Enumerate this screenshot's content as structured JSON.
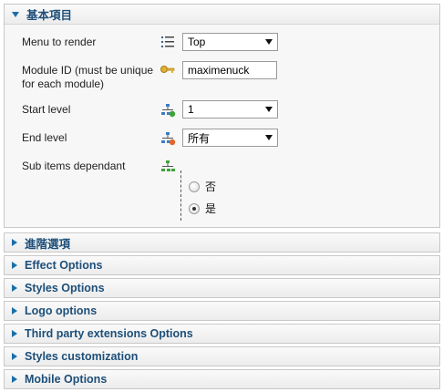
{
  "basic_section": {
    "title": "基本項目",
    "menu_to_render": {
      "label": "Menu to render",
      "icon": "list-icon",
      "value": "Top"
    },
    "module_id": {
      "label_line1": "Module ID (must be unique",
      "label_line2": "for each module)",
      "icon": "key-icon",
      "value": "maximenuck"
    },
    "start_level": {
      "label": "Start level",
      "icon": "sitemap-green-icon",
      "value": "1"
    },
    "end_level": {
      "label": "End level",
      "icon": "sitemap-red-icon",
      "value": "所有"
    },
    "sub_items_dependant": {
      "label": "Sub items dependant",
      "icon": "sitemap-icon",
      "options": [
        {
          "label": "否",
          "checked": false
        },
        {
          "label": "是",
          "checked": true
        }
      ]
    }
  },
  "collapsed_sections": [
    {
      "title": "進階選項"
    },
    {
      "title": "Effect Options"
    },
    {
      "title": "Styles Options"
    },
    {
      "title": "Logo options"
    },
    {
      "title": "Third party extensions Options"
    },
    {
      "title": "Styles customization"
    },
    {
      "title": "Mobile Options"
    }
  ]
}
